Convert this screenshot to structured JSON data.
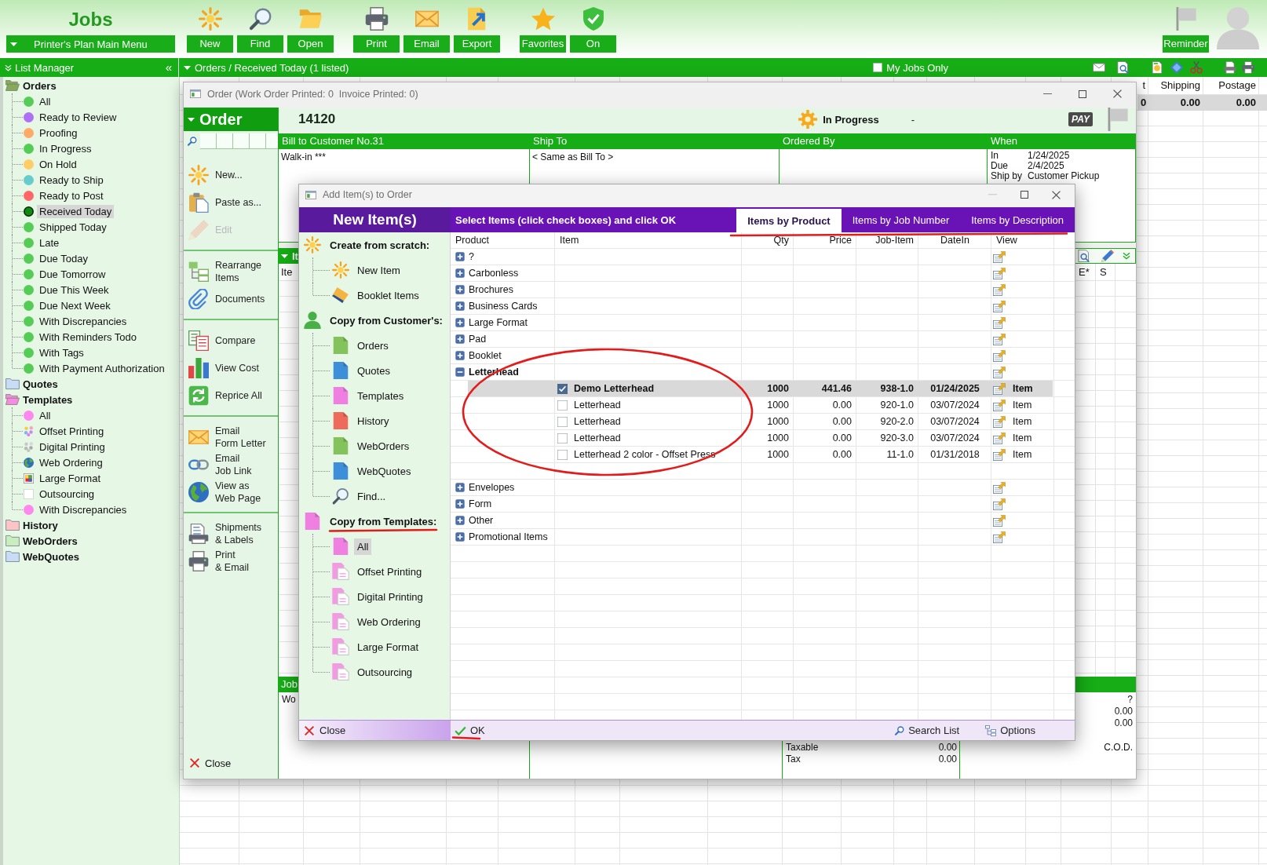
{
  "app_header": {
    "title": "Jobs",
    "main_menu": "Printer's Plan Main Menu"
  },
  "toolbar_groups": [
    [
      {
        "label": "New"
      },
      {
        "label": "Find"
      },
      {
        "label": "Open"
      }
    ],
    [
      {
        "label": "Print"
      },
      {
        "label": "Email"
      },
      {
        "label": "Export"
      }
    ],
    [
      {
        "label": "Favorites"
      },
      {
        "label": "On"
      }
    ]
  ],
  "reminder": {
    "label": "Reminder"
  },
  "list_manager": {
    "title": "List Manager",
    "collapse": "«",
    "tree": [
      {
        "label": "Orders",
        "expanded": true,
        "selected": false,
        "color": "#8aa85c",
        "children": [
          {
            "label": "All",
            "kind": "dot",
            "color": "#55cc55",
            "selected": false
          },
          {
            "label": "Ready to Review",
            "kind": "dot",
            "color": "#b070f5",
            "selected": false
          },
          {
            "label": "Proofing",
            "kind": "dot",
            "color": "#ffaa66",
            "selected": false
          },
          {
            "label": "In Progress",
            "kind": "dot",
            "color": "#55cc55",
            "selected": false
          },
          {
            "label": "On Hold",
            "kind": "dot",
            "color": "#ffcc66",
            "selected": false
          },
          {
            "label": "Ready to Ship",
            "kind": "dot",
            "color": "#66cccc",
            "selected": false
          },
          {
            "label": "Ready to Post",
            "kind": "dot",
            "color": "#ff6666",
            "selected": false
          },
          {
            "label": "Received Today",
            "kind": "dot",
            "color": "#108a10",
            "selected": true
          },
          {
            "label": "Shipped Today",
            "kind": "dot",
            "color": "#55cc55",
            "selected": false
          },
          {
            "label": "Late",
            "kind": "dot",
            "color": "#55cc55",
            "selected": false
          },
          {
            "label": "Due Today",
            "kind": "dot",
            "color": "#55cc55",
            "selected": false
          },
          {
            "label": "Due Tomorrow",
            "kind": "dot",
            "color": "#55cc55",
            "selected": false
          },
          {
            "label": "Due This Week",
            "kind": "dot",
            "color": "#55cc55",
            "selected": false
          },
          {
            "label": "Due Next Week",
            "kind": "dot",
            "color": "#55cc55",
            "selected": false
          },
          {
            "label": "With Discrepancies",
            "kind": "dot",
            "color": "#55cc55",
            "selected": false
          },
          {
            "label": "With Reminders Todo",
            "kind": "dot",
            "color": "#55cc55",
            "selected": false
          },
          {
            "label": "With Tags",
            "kind": "dot",
            "color": "#55cc55",
            "selected": false
          },
          {
            "label": "With Payment Authorization",
            "kind": "dot",
            "color": "#55cc55",
            "selected": false
          }
        ]
      },
      {
        "label": "Quotes",
        "expanded": false,
        "selected": false,
        "color": "#c9dcf3"
      },
      {
        "label": "Templates",
        "expanded": true,
        "selected": false,
        "color": "#f58be2",
        "children": [
          {
            "label": "All",
            "kind": "dot",
            "color": "#ff88ee",
            "selected": false
          },
          {
            "label": "Offset Printing",
            "kind": "palette",
            "selected": false
          },
          {
            "label": "Digital Printing",
            "kind": "greydots",
            "selected": false
          },
          {
            "label": "Web Ordering",
            "kind": "globe",
            "selected": false
          },
          {
            "label": "Large Format",
            "kind": "swatch",
            "selected": false
          },
          {
            "label": "Outsourcing",
            "kind": "blank",
            "selected": false
          },
          {
            "label": "With Discrepancies",
            "kind": "dot",
            "color": "#ff88ee",
            "selected": false
          }
        ]
      },
      {
        "label": "History",
        "expanded": false,
        "selected": false,
        "color": "#ffc4c4"
      },
      {
        "label": "WebOrders",
        "expanded": false,
        "selected": false,
        "color": "#c9eebb"
      },
      {
        "label": "WebQuotes",
        "expanded": false,
        "selected": false,
        "color": "#c9dcf3"
      }
    ]
  },
  "list_header": {
    "title": "Orders / Received Today (1 listed)",
    "my_jobs_only": {
      "label": "My Jobs Only",
      "checked": false
    }
  },
  "background_list": {
    "columns": [
      "t",
      "Shipping",
      "Postage"
    ],
    "rows": [
      {
        "cells": [
          "0",
          "0.00",
          "0.00"
        ],
        "selected": true
      }
    ]
  },
  "order_window": {
    "title": "Order (Work Order Printed: 0  Invoice Printed: 0)",
    "panel_title": "Order",
    "action_groups": [
      [
        {
          "label": "New...",
          "disabled": false
        },
        {
          "label": "Paste as...",
          "disabled": false
        },
        {
          "label": "Edit",
          "disabled": true
        }
      ],
      [
        {
          "label": "Rearrange\nItems",
          "disabled": false
        },
        {
          "label": "Documents",
          "disabled": false
        }
      ],
      [
        {
          "label": "Compare",
          "disabled": false
        },
        {
          "label": "View Cost",
          "disabled": false
        },
        {
          "label": "Reprice All",
          "disabled": false
        }
      ],
      [
        {
          "label": "Email\nForm Letter",
          "disabled": false
        },
        {
          "label": "Email\nJob Link",
          "disabled": false
        },
        {
          "label": "View as\nWeb Page",
          "disabled": false
        }
      ],
      [
        {
          "label": "Shipments\n& Labels",
          "disabled": false
        },
        {
          "label": "Print\n& Email",
          "disabled": false
        }
      ]
    ],
    "close": "Close",
    "order_number": "14120",
    "status": "In Progress",
    "status_note": "-",
    "pay_badge": "PAY",
    "panels": [
      {
        "title": "Bill to Customer No.31",
        "text": "Walk-in ***"
      },
      {
        "title": "Ship To",
        "text": "< Same as Bill To >"
      },
      {
        "title": "Ordered By"
      },
      {
        "title": "When",
        "rows": [
          {
            "label": "In",
            "value": "1/24/2025"
          },
          {
            "label": "Due",
            "value": "2/4/2025"
          },
          {
            "label": "Ship by",
            "value": "Customer Pickup"
          }
        ]
      }
    ],
    "items_section": {
      "title": "It",
      "first_column": "Ite",
      "columns": [
        "E*",
        "S"
      ]
    },
    "jobs_section": {
      "title": "Job",
      "text": "Wo"
    },
    "summary": [
      {
        "label": "Taxable",
        "value": "0.00"
      },
      {
        "label": "Tax",
        "value": "0.00"
      }
    ],
    "right_values": [
      "?",
      "0.00",
      "0.00"
    ],
    "payment_terms": "C.O.D."
  },
  "dialog": {
    "title": "Add Item(s) to Order",
    "heading": "New Item(s)",
    "instruction": "Select Items (click check boxes) and click OK",
    "tabs": [
      {
        "label": "Items by Product",
        "selected": true
      },
      {
        "label": "Items by Job Number",
        "selected": false
      },
      {
        "label": "Items by Description",
        "selected": false
      }
    ],
    "sources": [
      {
        "label": "Create from scratch:",
        "kind": "sun",
        "children": [
          {
            "label": "New Item",
            "kind": "sun",
            "selected": false
          },
          {
            "label": "Booklet Items",
            "kind": "book",
            "selected": false
          }
        ]
      },
      {
        "label": "Copy from Customer's:",
        "kind": "person",
        "children": [
          {
            "label": "Orders",
            "kind": "doc",
            "color": "#84c25c",
            "selected": false
          },
          {
            "label": "Quotes",
            "kind": "doc",
            "color": "#3d8fd9",
            "selected": false
          },
          {
            "label": "Templates",
            "kind": "doc",
            "color": "#ef7fe0",
            "selected": false
          },
          {
            "label": "History",
            "kind": "doc",
            "color": "#ee6a5a",
            "selected": false
          },
          {
            "label": "WebOrders",
            "kind": "doc",
            "color": "#84c25c",
            "selected": false
          },
          {
            "label": "WebQuotes",
            "kind": "doc",
            "color": "#3d8fd9",
            "selected": false
          },
          {
            "label": "Find...",
            "kind": "search",
            "selected": false
          }
        ]
      },
      {
        "label": "Copy from Templates:",
        "kind": "doc",
        "color": "#ef7fe0",
        "children": [
          {
            "label": "All",
            "kind": "doc",
            "color": "#ef7fe0",
            "selected": true
          },
          {
            "label": "Offset Printing",
            "kind": "pages",
            "selected": false
          },
          {
            "label": "Digital Printing",
            "kind": "pages",
            "selected": false
          },
          {
            "label": "Web Ordering",
            "kind": "pages",
            "selected": false
          },
          {
            "label": "Large Format",
            "kind": "pages",
            "selected": false
          },
          {
            "label": "Outsourcing",
            "kind": "pages",
            "selected": false
          }
        ]
      }
    ],
    "columns": [
      "Product",
      "Item",
      "Qty",
      "Price",
      "Job-Item",
      "DateIn",
      "View"
    ],
    "products": [
      {
        "name": "?",
        "expanded": false
      },
      {
        "name": "Carbonless",
        "expanded": false
      },
      {
        "name": "Brochures",
        "expanded": false
      },
      {
        "name": "Business Cards",
        "expanded": false
      },
      {
        "name": "Large Format",
        "expanded": false
      },
      {
        "name": "Pad",
        "expanded": false
      },
      {
        "name": "Booklet",
        "expanded": false
      },
      {
        "name": "Letterhead",
        "expanded": true,
        "items": [
          {
            "item": "Demo Letterhead",
            "checked": true,
            "selected": true,
            "qty": "1000",
            "price": "441.46",
            "job_item": "938-1.0",
            "date_in": "01/24/2025",
            "view": "Item"
          },
          {
            "item": "Letterhead",
            "checked": false,
            "selected": false,
            "qty": "1000",
            "price": "0.00",
            "job_item": "920-1.0",
            "date_in": "03/07/2024",
            "view": "Item"
          },
          {
            "item": "Letterhead",
            "checked": false,
            "selected": false,
            "qty": "1000",
            "price": "0.00",
            "job_item": "920-2.0",
            "date_in": "03/07/2024",
            "view": "Item"
          },
          {
            "item": "Letterhead",
            "checked": false,
            "selected": false,
            "qty": "1000",
            "price": "0.00",
            "job_item": "920-3.0",
            "date_in": "03/07/2024",
            "view": "Item"
          },
          {
            "item": "Letterhead 2 color - Offset Press",
            "checked": false,
            "selected": false,
            "qty": "1000",
            "price": "0.00",
            "job_item": "11-1.0",
            "date_in": "01/31/2018",
            "view": "Item"
          }
        ]
      },
      {
        "name": "Envelopes",
        "expanded": false
      },
      {
        "name": "Form",
        "expanded": false
      },
      {
        "name": "Other",
        "expanded": false
      },
      {
        "name": "Promotional Items",
        "expanded": false
      }
    ],
    "footer": {
      "close": "Close",
      "ok": "OK",
      "search": "Search List",
      "options": "Options"
    }
  }
}
